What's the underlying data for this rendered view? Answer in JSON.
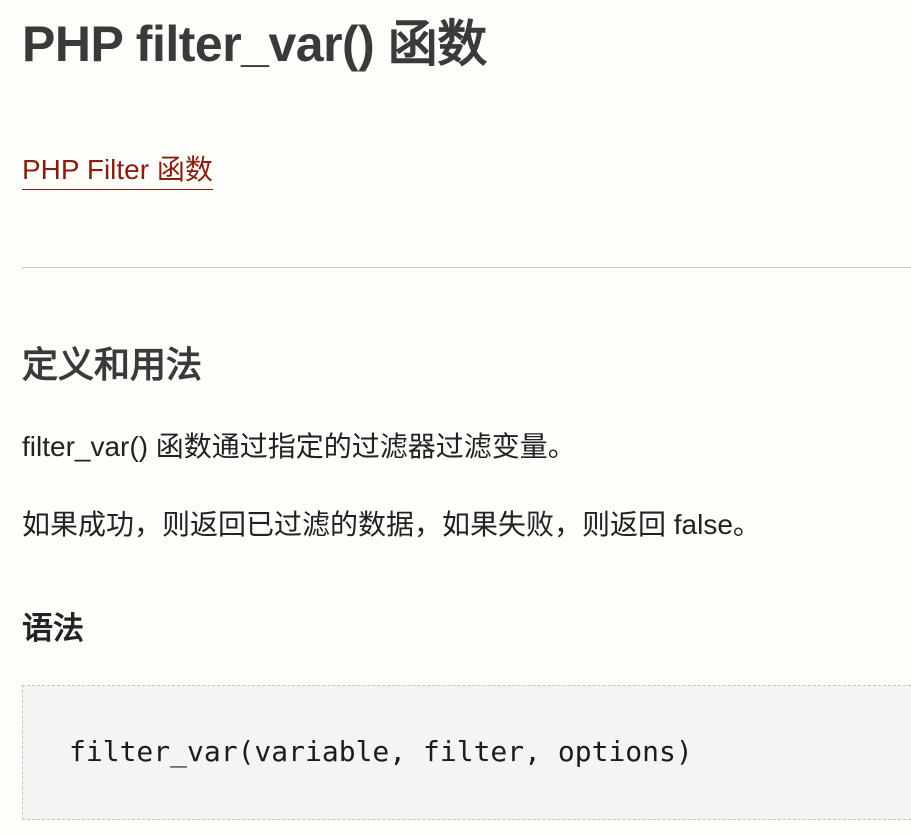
{
  "header": {
    "title": "PHP filter_var() 函数"
  },
  "breadcrumb": {
    "category_link": "PHP Filter 函数"
  },
  "definition": {
    "heading": "定义和用法",
    "paragraphs": [
      "filter_var() 函数通过指定的过滤器过滤变量。",
      "如果成功，则返回已过滤的数据，如果失败，则返回 false。"
    ]
  },
  "syntax": {
    "heading": "语法",
    "code": "filter_var(variable, filter, options)"
  },
  "colors": {
    "link": "#8a1f11",
    "background": "#fdfdf9",
    "code_background": "#f4f4f2"
  }
}
